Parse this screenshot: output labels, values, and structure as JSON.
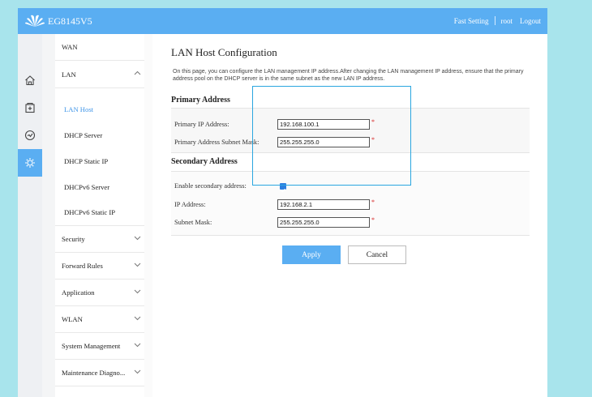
{
  "header": {
    "model": "EG8145V5",
    "links": [
      "Fast Setting",
      "root",
      "Logout"
    ]
  },
  "sidebar": {
    "icons": [
      "home-icon",
      "plus-box-icon",
      "status-check-icon",
      "settings-gear-icon"
    ],
    "items": [
      {
        "label": "WAN"
      },
      {
        "label": "LAN"
      },
      {
        "label": "LAN Host"
      },
      {
        "label": "DHCP Server"
      },
      {
        "label": "DHCP Static IP"
      },
      {
        "label": "DHCPv6 Server"
      },
      {
        "label": "DHCPv6 Static IP"
      },
      {
        "label": "Security"
      },
      {
        "label": "Forward Rules"
      },
      {
        "label": "Application"
      },
      {
        "label": "WLAN"
      },
      {
        "label": "System Management"
      },
      {
        "label": "Maintenance Diagno..."
      }
    ]
  },
  "main": {
    "title": "LAN Host Configuration",
    "description": "On this page, you can configure the LAN management IP address.After changing the LAN management IP address, ensure that the primary address pool on the DHCP server is in the same subnet as the new LAN IP address.",
    "primary": {
      "title": "Primary Address",
      "ip_label": "Primary IP Address:",
      "ip_value": "192.168.100.1",
      "mask_label": "Primary Address Subnet Mask:",
      "mask_value": "255.255.255.0"
    },
    "secondary": {
      "title": "Secondary Address",
      "enable_label": "Enable secondary address:",
      "enable_checked": true,
      "ip_label": "IP Address:",
      "ip_value": "192.168.2.1",
      "mask_label": "Subnet Mask:",
      "mask_value": "255.255.255.0"
    },
    "required_mark": "*",
    "apply_label": "Apply",
    "cancel_label": "Cancel"
  },
  "colors": {
    "accent": "#5aaef2",
    "highlight_box": "#2aa6e0",
    "required": "#d62020",
    "background": "#a8e4ec"
  }
}
